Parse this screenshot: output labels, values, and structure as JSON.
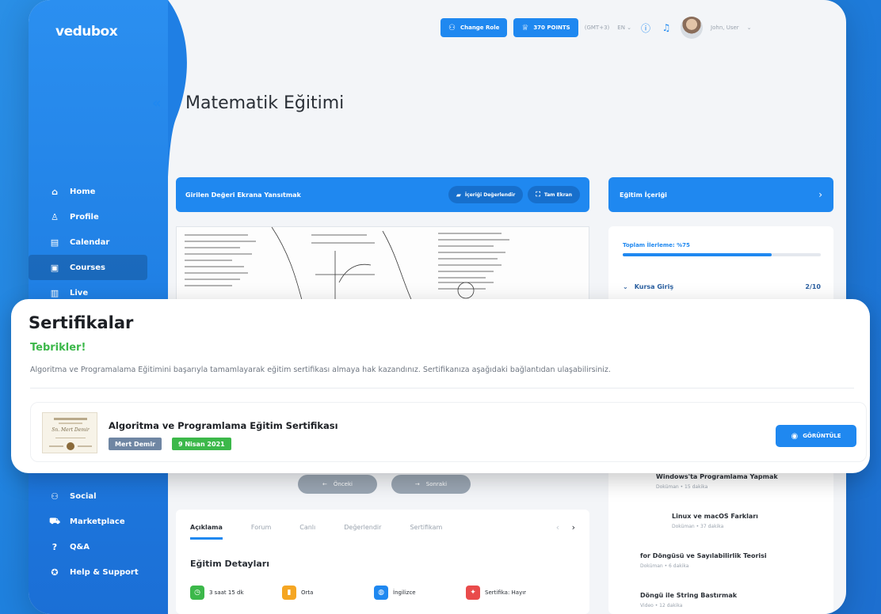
{
  "app": {
    "logo": "vedubox"
  },
  "sidebar": {
    "items": [
      {
        "label": "Home",
        "icon": "home-icon"
      },
      {
        "label": "Profile",
        "icon": "user-icon"
      },
      {
        "label": "Calendar",
        "icon": "calendar-icon"
      },
      {
        "label": "Courses",
        "icon": "courses-icon"
      },
      {
        "label": "Live",
        "icon": "live-icon"
      }
    ],
    "bottom_items": [
      {
        "label": "Social",
        "icon": "social-icon"
      },
      {
        "label": "Marketplace",
        "icon": "cart-icon"
      },
      {
        "label": "Q&A",
        "icon": "qa-icon"
      },
      {
        "label": "Help & Support",
        "icon": "help-icon"
      }
    ]
  },
  "header": {
    "change_role": "Change Role",
    "points": "370 POINTS",
    "timezone": "(GMT+3)",
    "language": "EN",
    "user_name": "John, User"
  },
  "page": {
    "title": "Matematik Eğitimi"
  },
  "player": {
    "title": "Girilen Değeri Ekrana Yansıtmak",
    "rate_label": "İçeriği Değerlendir",
    "fullscreen_label": "Tam Ekran"
  },
  "content_panel": {
    "title": "Eğitim İçeriği",
    "progress_label": "Toplam İlerleme: %75",
    "progress": 0.75,
    "section_name": "Kursa Giriş",
    "section_count": "2/10",
    "lessons": [
      {
        "title": "Windows'ta Programlama Yapmak",
        "meta": "Doküman • 15 dakika"
      },
      {
        "title": "Linux ve macOS Farkları",
        "meta": "Doküman • 37 dakika"
      },
      {
        "title": "for Döngüsü ve Sayılabilirlik Teorisi",
        "meta": "Doküman • 6 dakika"
      },
      {
        "title": "Döngü ile String Bastırmak",
        "meta": "Video • 12 dakika"
      }
    ]
  },
  "pager": {
    "prev": "Önceki",
    "next": "Sonraki"
  },
  "tabs": {
    "items": [
      "Açıklama",
      "Forum",
      "Canlı",
      "Değerlendir",
      "Sertifikam"
    ],
    "details_title": "Eğitim Detayları",
    "details": [
      {
        "label": "3 saat 15 dk",
        "color": "#3cb84a"
      },
      {
        "label": "Orta",
        "color": "#f5a623"
      },
      {
        "label": "İngilizce",
        "color": "#1f88f0"
      },
      {
        "label": "Sertifika: Hayır",
        "color": "#e94b4b"
      }
    ]
  },
  "certificates": {
    "title": "Sertifikalar",
    "congrats": "Tebrikler!",
    "description": "Algoritma ve Programalama Eğitimini başarıyla tamamlayarak eğitim sertifikası almaya hak kazandınız. Sertifikanıza aşağıdaki bağlantıdan ulaşabilirsiniz.",
    "item": {
      "name": "Algoritma ve Programlama Eğitim Sertifikası",
      "owner": "Mert Demir",
      "date": "9 Nisan 2021",
      "view_label": "GÖRÜNTÜLE",
      "thumb_text": "Sn. Mert Demir"
    }
  },
  "colors": {
    "accent": "#1f88f0",
    "success": "#3cb84a",
    "owner_tag": "#6f86a3"
  }
}
